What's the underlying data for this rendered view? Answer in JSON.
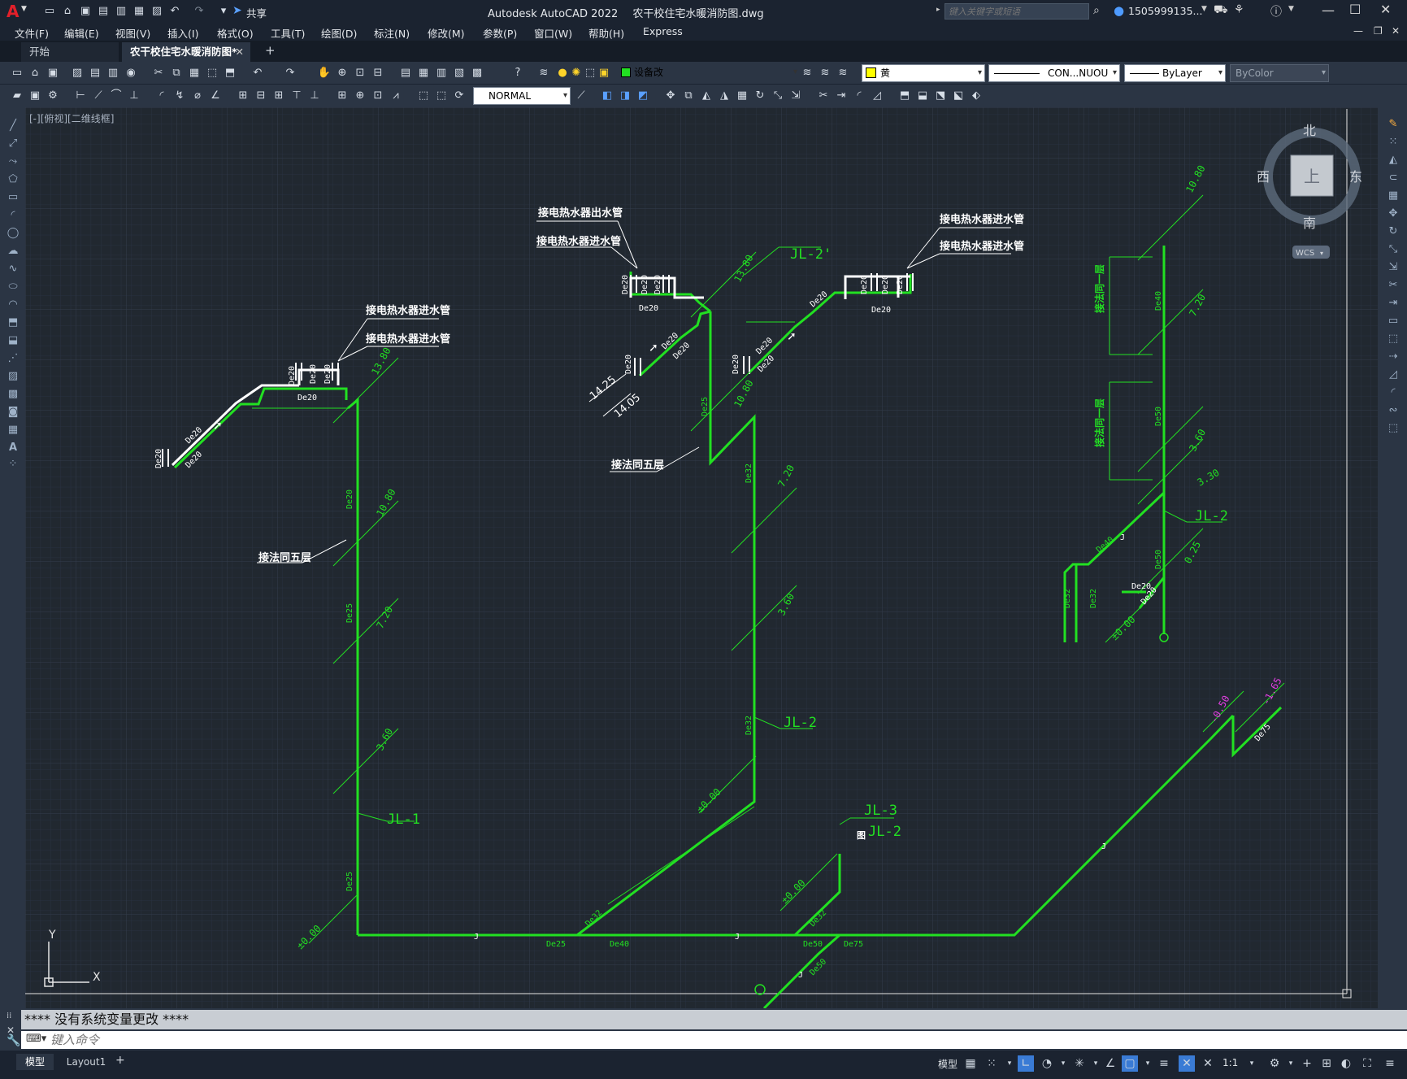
{
  "title_bar": {
    "app_title": "Autodesk AutoCAD 2022",
    "file_name": "农干校住宅水暖消防图.dwg",
    "share_label": "共享",
    "search_placeholder": "键入关键字或短语",
    "user": "1505999135...",
    "logo": "A"
  },
  "menu": [
    "文件(F)",
    "编辑(E)",
    "视图(V)",
    "插入(I)",
    "格式(O)",
    "工具(T)",
    "绘图(D)",
    "标注(N)",
    "修改(M)",
    "参数(P)",
    "窗口(W)",
    "帮助(H)",
    "Express"
  ],
  "doc_tabs": {
    "start": "开始",
    "active": "农干校住宅水暖消防图*",
    "add": "+"
  },
  "toolbar": {
    "layer": "设备改",
    "color": "黄",
    "linetype": "CON...NUOU",
    "lineweight": "ByLayer",
    "plotstyle": "ByColor",
    "dimstyle": "NORMAL"
  },
  "viewport": {
    "label": "[-][俯视][二维线框]"
  },
  "viewcube": {
    "north": "北",
    "south": "南",
    "east": "东",
    "west": "西",
    "face": "上",
    "wcs": "WCS"
  },
  "ucs": {
    "x": "X",
    "y": "Y"
  },
  "colors": {
    "pipe": "#22e022",
    "annotation": "#ffffff",
    "elev_neg": "#e040e0",
    "background": "#212830"
  },
  "drawing": {
    "labels": {
      "heater_in": "接电热水器进水管",
      "heater_out": "接电热水器出水管",
      "same_as_5": "接法同五层",
      "same_as_1": "接法同一层",
      "jl1": "JL-1",
      "jl2": "JL-2",
      "jl2p": "JL-2'",
      "jl3": "JL-3",
      "ann_box": "图"
    },
    "elevations": [
      "13.80",
      "10.80",
      "7.20",
      "3.60",
      "±0.00",
      "14.25",
      "14.05",
      "3.30",
      "0.25",
      "-0.50",
      "-1.65"
    ],
    "sizes": [
      "De20",
      "De25",
      "De32",
      "De40",
      "De50",
      "De75"
    ],
    "marks": {
      "j": "J"
    }
  },
  "command": {
    "history": "****  没有系统变量更改  ****",
    "placeholder": "键入命令"
  },
  "layout_tabs": [
    "模型",
    "Layout1",
    "+"
  ],
  "status": {
    "model": "模型",
    "scale": "1:1"
  }
}
